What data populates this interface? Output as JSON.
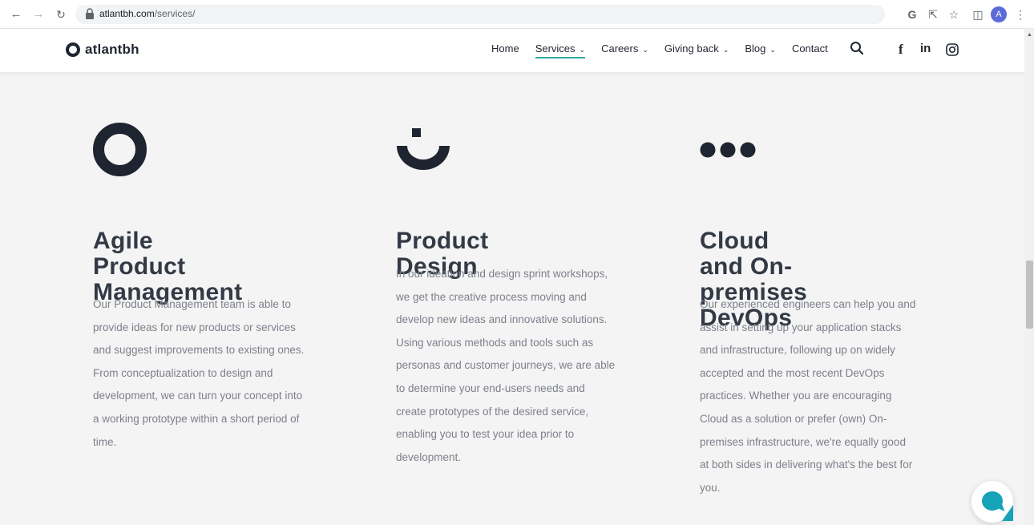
{
  "browser": {
    "url_host": "atlantbh.com",
    "url_path": "/services/",
    "profile_initial": "A"
  },
  "header": {
    "logo_text": "atlantbh",
    "nav": [
      {
        "label": "Home",
        "has_dropdown": false
      },
      {
        "label": "Services",
        "has_dropdown": true,
        "active": true
      },
      {
        "label": "Careers",
        "has_dropdown": true
      },
      {
        "label": "Giving back",
        "has_dropdown": true
      },
      {
        "label": "Blog",
        "has_dropdown": true
      },
      {
        "label": "Contact",
        "has_dropdown": false
      }
    ],
    "social": {
      "facebook": "f",
      "linkedin": "in"
    }
  },
  "services": [
    {
      "icon": "ring-icon",
      "title_lines": [
        "Agile Product",
        "Management"
      ],
      "description_lines": [
        "Our Product Management team is able to",
        "provide ideas for new products or services",
        "and suggest improvements to existing ones.",
        "From conceptualization to design and",
        "development, we can turn your concept into",
        "a working prototype within a short period of",
        "time."
      ]
    },
    {
      "icon": "arc-icon",
      "title_lines": [
        "Product Design"
      ],
      "description_lines": [
        "In our ideation and design sprint workshops,",
        "we get the creative process moving and",
        "develop new ideas and innovative solutions.",
        "Using various methods and tools such as",
        "personas and customer journeys, we are able",
        "to determine your end-users needs and",
        "create prototypes of the desired service,",
        "enabling you to test your idea prior to",
        "development."
      ]
    },
    {
      "icon": "dots-icon",
      "title_lines": [
        "Cloud and On-",
        "premises DevOps"
      ],
      "description_lines": [
        "Our experienced engineers can help you and",
        "assist in setting up your application stacks",
        "and infrastructure, following up on widely",
        "accepted and the most recent DevOps",
        "practices. Whether you are encouraging",
        "Cloud as a solution or prefer (own) On-",
        "premises infrastructure, we're equally good",
        "at both sides in delivering what's the best for",
        "you."
      ]
    }
  ],
  "colors": {
    "accent": "#34a9a4",
    "dark": "#1f2530",
    "chat": "#16a3b7",
    "page_bg": "#f4f4f5"
  }
}
